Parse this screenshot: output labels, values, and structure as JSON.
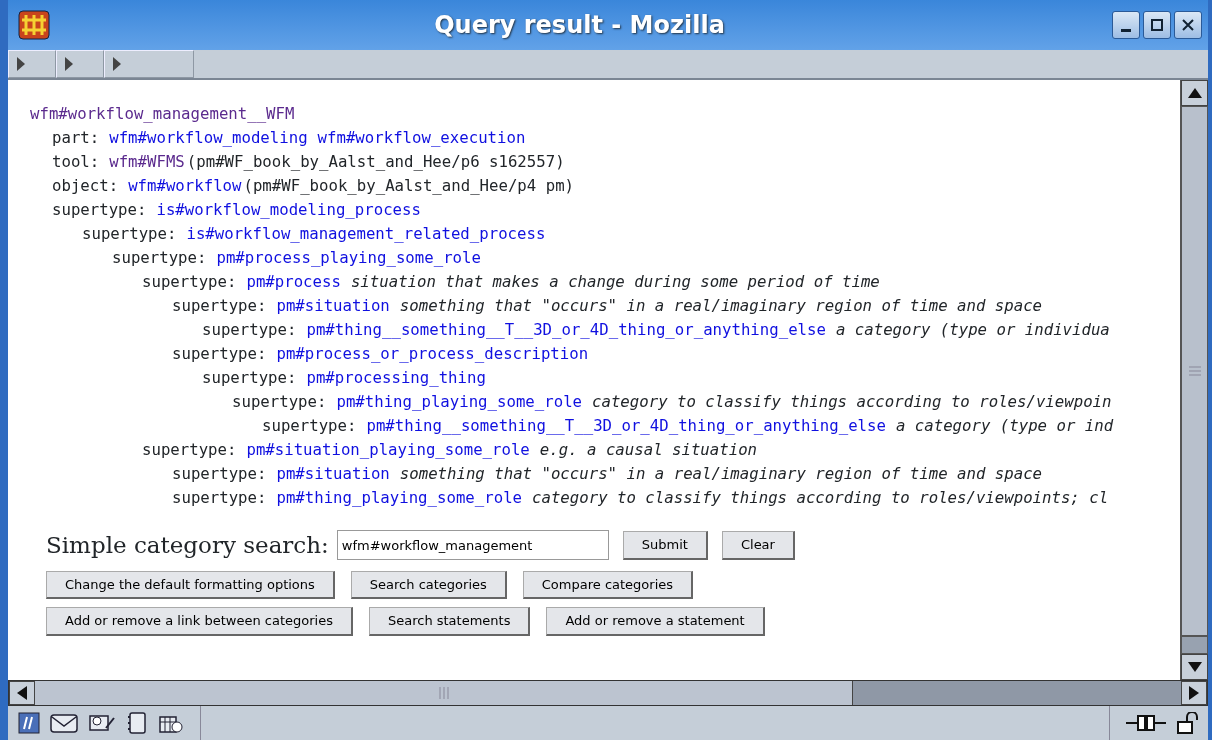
{
  "window": {
    "title": "Query result - Mozilla"
  },
  "record": {
    "term": {
      "text": "wfm#workflow_management__WFM",
      "visited": true
    },
    "relations": [
      {
        "label": "part:",
        "terms": [
          {
            "text": "wfm#workflow_modeling",
            "visited": false
          },
          {
            "text": "wfm#workflow_execution",
            "visited": false
          }
        ]
      },
      {
        "label": "tool:",
        "terms": [
          {
            "text": "wfm#WFMS",
            "visited": true
          }
        ],
        "source": "(pm#WF_book_by_Aalst_and_Hee/p6 s162557)"
      },
      {
        "label": "object:",
        "terms": [
          {
            "text": "wfm#workflow",
            "visited": false
          }
        ],
        "source": "(pm#WF_book_by_Aalst_and_Hee/p4 pm)"
      },
      {
        "label": "supertype:",
        "terms": [
          {
            "text": "is#workflow_modeling_process",
            "visited": false
          }
        ],
        "children": [
          {
            "label": "supertype:",
            "terms": [
              {
                "text": "is#workflow_management_related_process",
                "visited": false
              }
            ],
            "children": [
              {
                "label": "supertype:",
                "terms": [
                  {
                    "text": "pm#process_playing_some_role",
                    "visited": false
                  }
                ],
                "children": [
                  {
                    "label": "supertype:",
                    "terms": [
                      {
                        "text": "pm#process",
                        "visited": false
                      }
                    ],
                    "note": "situation that makes a change during some period of time",
                    "children": [
                      {
                        "label": "supertype:",
                        "terms": [
                          {
                            "text": "pm#situation",
                            "visited": false
                          }
                        ],
                        "note": "something that \"occurs\" in a real/imaginary region of time and space",
                        "children": [
                          {
                            "label": "supertype:",
                            "terms": [
                              {
                                "text": "pm#thing__something__T__3D_or_4D_thing_or_anything_else",
                                "visited": false
                              }
                            ],
                            "note": "a category (type or individua"
                          }
                        ]
                      },
                      {
                        "label": "supertype:",
                        "terms": [
                          {
                            "text": "pm#process_or_process_description",
                            "visited": false
                          }
                        ],
                        "children": [
                          {
                            "label": "supertype:",
                            "terms": [
                              {
                                "text": "pm#processing_thing",
                                "visited": false
                              }
                            ],
                            "children": [
                              {
                                "label": "supertype:",
                                "terms": [
                                  {
                                    "text": "pm#thing_playing_some_role",
                                    "visited": false
                                  }
                                ],
                                "note": "category to classify things according to roles/viewpoin",
                                "children": [
                                  {
                                    "label": "supertype:",
                                    "terms": [
                                      {
                                        "text": "pm#thing__something__T__3D_or_4D_thing_or_anything_else",
                                        "visited": false
                                      }
                                    ],
                                    "note": "a category (type or ind"
                                  }
                                ]
                              }
                            ]
                          }
                        ]
                      }
                    ]
                  },
                  {
                    "label": "supertype:",
                    "terms": [
                      {
                        "text": "pm#situation_playing_some_role",
                        "visited": false
                      }
                    ],
                    "note": "e.g. a causal situation",
                    "children": [
                      {
                        "label": "supertype:",
                        "terms": [
                          {
                            "text": "pm#situation",
                            "visited": false
                          }
                        ],
                        "note": "something that \"occurs\" in a real/imaginary region of time and space"
                      },
                      {
                        "label": "supertype:",
                        "terms": [
                          {
                            "text": "pm#thing_playing_some_role",
                            "visited": false
                          }
                        ],
                        "note": "category to classify things according to roles/viewpoints; cl"
                      }
                    ]
                  }
                ]
              }
            ]
          }
        ]
      }
    ]
  },
  "search": {
    "label": "Simple category search:",
    "value": "wfm#workflow_management",
    "buttons": [
      "Submit",
      "Clear"
    ]
  },
  "button_rows": [
    [
      "Change the default formatting options",
      "Search categories",
      "Compare categories"
    ],
    [
      "Add or remove a link between categories",
      "Search statements",
      "Add or remove a statement"
    ]
  ]
}
